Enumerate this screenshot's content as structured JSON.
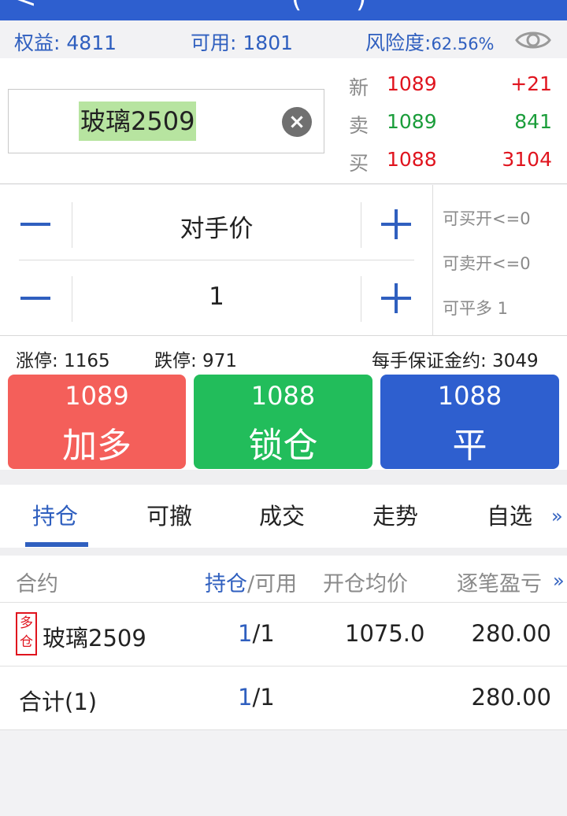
{
  "top_bar": {
    "glyphs": [
      "<",
      "(",
      ")"
    ]
  },
  "account": {
    "equity_label": "权益:",
    "equity_value": "4811",
    "available_label": "可用:",
    "available_value": "1801",
    "risk_label": "风险度:",
    "risk_value": "62.56%",
    "eye_icon": "eye-icon"
  },
  "contract": {
    "name": "玻璃2509",
    "clear_icon": "×"
  },
  "quote": {
    "last": {
      "label": "新",
      "price": "1089",
      "value": "+21"
    },
    "ask": {
      "label": "卖",
      "price": "1089",
      "value": "841"
    },
    "bid": {
      "label": "买",
      "price": "1088",
      "value": "3104"
    }
  },
  "order": {
    "price_type": "对手价",
    "quantity": "1",
    "can_buy_open": "可买开<=0",
    "can_sell_open": "可卖开<=0",
    "can_close_long": "可平多 1"
  },
  "limits": {
    "limit_up": "涨停: 1165",
    "limit_down": "跌停: 971",
    "margin": "每手保证金约: 3049"
  },
  "actions": [
    {
      "price": "1089",
      "label": "加多",
      "color": "#f45f5a"
    },
    {
      "price": "1088",
      "label": "锁仓",
      "color": "#22bd5b"
    },
    {
      "price": "1088",
      "label": "平",
      "color": "#2e5fcf"
    }
  ],
  "tabs": [
    "持仓",
    "可撤",
    "成交",
    "走势",
    "自选"
  ],
  "tabs_more": "»",
  "table": {
    "headers": {
      "contract": "合约",
      "position_hl": "持仓",
      "position_rest": "/可用",
      "avg_price": "开仓均价",
      "pnl": "逐笔盈亏"
    },
    "more": "»",
    "rows": [
      {
        "badge_top": "多",
        "badge_bottom": "仓",
        "contract": "玻璃2509",
        "pos": "1",
        "avail": "/1",
        "avg_price": "1075.0",
        "pnl": "280.00"
      }
    ],
    "total": {
      "label": "合计(1)",
      "pos": "1",
      "avail": "/1",
      "pnl": "280.00"
    }
  }
}
